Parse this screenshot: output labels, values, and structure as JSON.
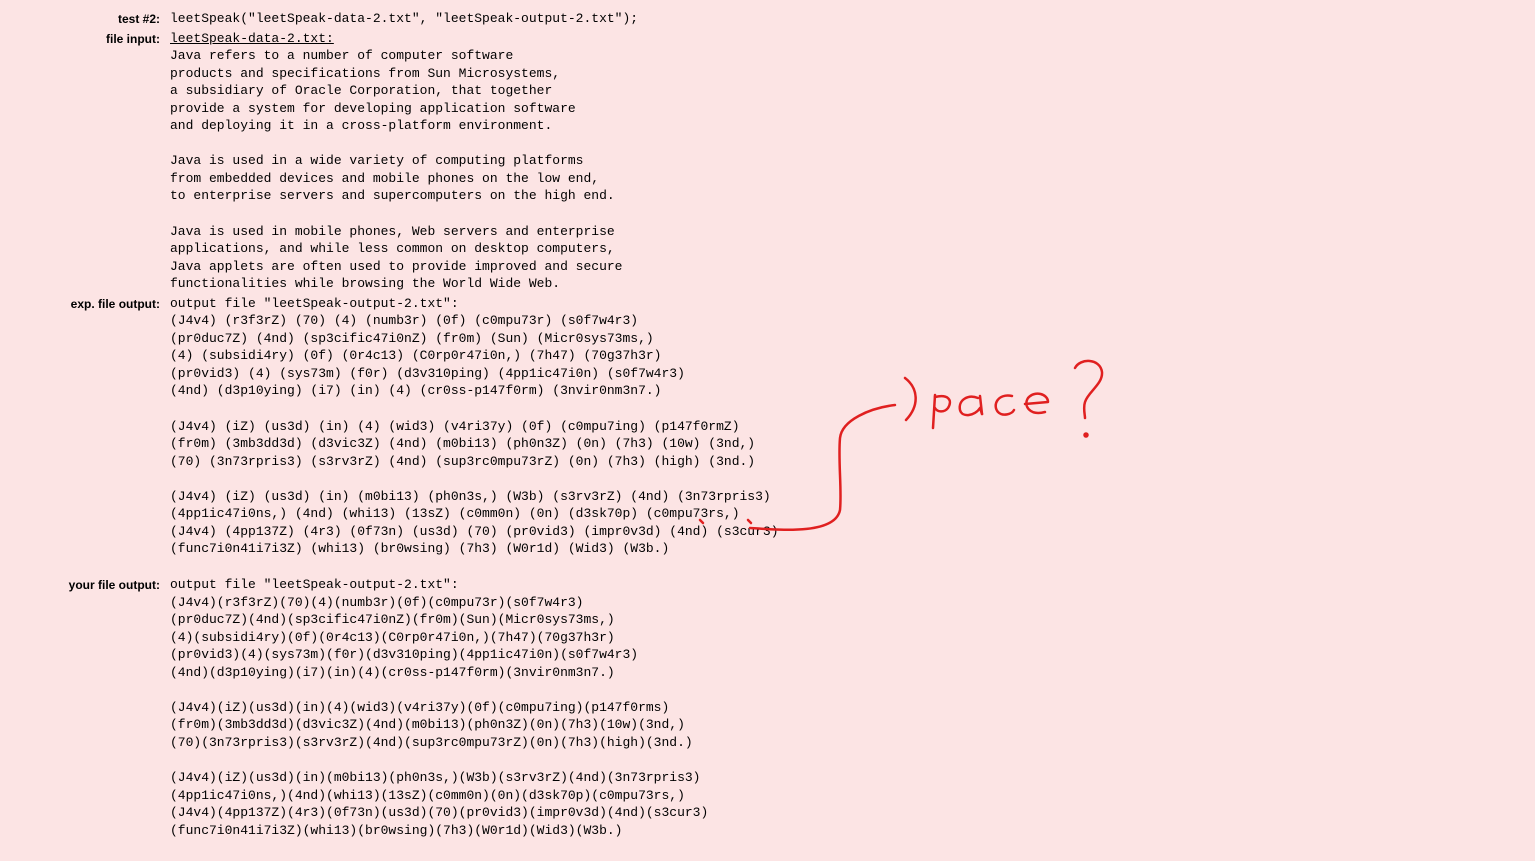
{
  "test2": {
    "label": "test #2:",
    "value": "leetSpeak(\"leetSpeak-data-2.txt\", \"leetSpeak-output-2.txt\");"
  },
  "fileInput": {
    "label": "file input:",
    "filename": "leetSpeak-data-2.txt:",
    "content": "Java refers to a number of computer software\nproducts and specifications from Sun Microsystems,\na subsidiary of Oracle Corporation, that together\nprovide a system for developing application software\nand deploying it in a cross-platform environment.\n\nJava is used in a wide variety of computing platforms\nfrom embedded devices and mobile phones on the low end,\nto enterprise servers and supercomputers on the high end.\n\nJava is used in mobile phones, Web servers and enterprise\napplications, and while less common on desktop computers,\nJava applets are often used to provide improved and secure\nfunctionalities while browsing the World Wide Web."
  },
  "expOutput": {
    "label": "exp. file output:",
    "header": "output file \"leetSpeak-output-2.txt\":",
    "content": "(J4v4) (r3f3rZ) (70) (4) (numb3r) (0f) (c0mpu73r) (s0f7w4r3)\n(pr0duc7Z) (4nd) (sp3cific47i0nZ) (fr0m) (Sun) (Micr0sys73ms,)\n(4) (subsidi4ry) (0f) (0r4c13) (C0rp0r47i0n,) (7h47) (70g37h3r)\n(pr0vid3) (4) (sys73m) (f0r) (d3v310ping) (4pp1ic47i0n) (s0f7w4r3)\n(4nd) (d3p10ying) (i7) (in) (4) (cr0ss-p147f0rm) (3nvir0nm3n7.)\n\n(J4v4) (iZ) (us3d) (in) (4) (wid3) (v4ri37y) (0f) (c0mpu7ing) (p147f0rmZ)\n(fr0m) (3mb3dd3d) (d3vic3Z) (4nd) (m0bi13) (ph0n3Z) (0n) (7h3) (10w) (3nd,)\n(70) (3n73rpris3) (s3rv3rZ) (4nd) (sup3rc0mpu73rZ) (0n) (7h3) (high) (3nd.)\n\n(J4v4) (iZ) (us3d) (in) (m0bi13) (ph0n3s,) (W3b) (s3rv3rZ) (4nd) (3n73rpris3)\n(4pp1ic47i0ns,) (4nd) (whi13) (13sZ) (c0mm0n) (0n) (d3sk70p) (c0mpu73rs,)\n(J4v4) (4pp137Z) (4r3) (0f73n) (us3d) (70) (pr0vid3) (impr0v3d) (4nd) (s3cur3)\n(func7i0n41i7i3Z) (whi13) (br0wsing) (7h3) (W0r1d) (Wid3) (W3b.)"
  },
  "yourOutput": {
    "label": "your file output:",
    "header": "output file \"leetSpeak-output-2.txt\":",
    "content": "(J4v4)(r3f3rZ)(70)(4)(numb3r)(0f)(c0mpu73r)(s0f7w4r3)\n(pr0duc7Z)(4nd)(sp3cific47i0nZ)(fr0m)(Sun)(Micr0sys73ms,)\n(4)(subsidi4ry)(0f)(0r4c13)(C0rp0r47i0n,)(7h47)(70g37h3r)\n(pr0vid3)(4)(sys73m)(f0r)(d3v310ping)(4pp1ic47i0n)(s0f7w4r3)\n(4nd)(d3p10ying)(i7)(in)(4)(cr0ss-p147f0rm)(3nvir0nm3n7.)\n\n(J4v4)(iZ)(us3d)(in)(4)(wid3)(v4ri37y)(0f)(c0mpu7ing)(p147f0rms)\n(fr0m)(3mb3dd3d)(d3vic3Z)(4nd)(m0bi13)(ph0n3Z)(0n)(7h3)(10w)(3nd,)\n(70)(3n73rpris3)(s3rv3rZ)(4nd)(sup3rc0mpu73rZ)(0n)(7h3)(high)(3nd.)\n\n(J4v4)(iZ)(us3d)(in)(m0bi13)(ph0n3s,)(W3b)(s3rv3rZ)(4nd)(3n73rpris3)\n(4pp1ic47i0ns,)(4nd)(whi13)(13sZ)(c0mm0n)(0n)(d3sk70p)(c0mpu73rs,)\n(J4v4)(4pp137Z)(4r3)(0f73n)(us3d)(70)(pr0vid3)(impr0v3d)(4nd)(s3cur3)\n(func7i0n41i7i3Z)(whi13)(br0wsing)(7h3)(W0r1d)(Wid3)(W3b.)"
  },
  "annotation": {
    "text": "Space ?"
  }
}
